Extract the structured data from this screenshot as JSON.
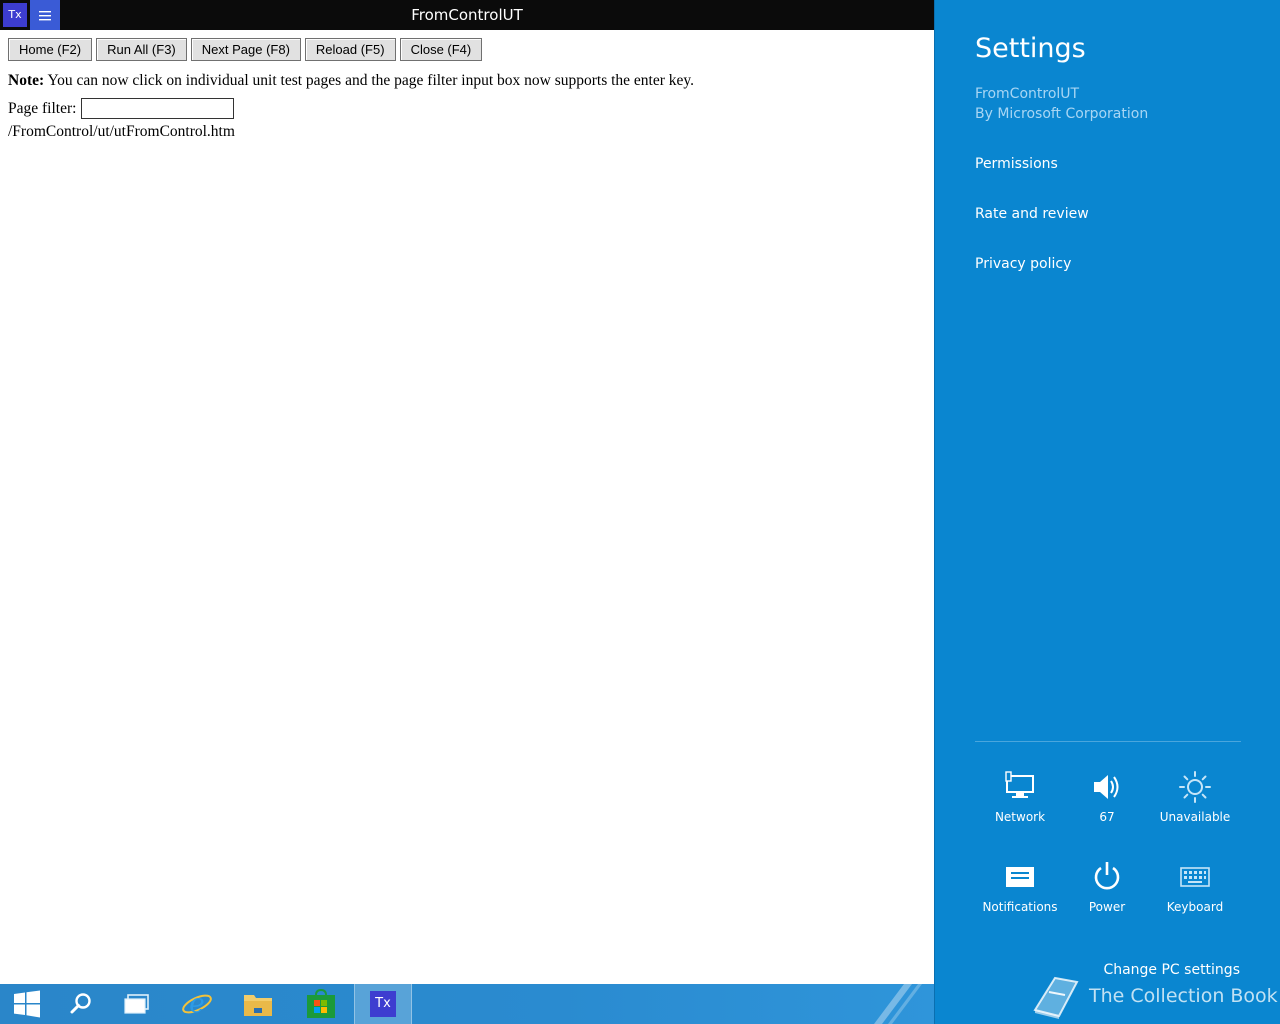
{
  "titlebar": {
    "app_icon_text": "Tx",
    "menu_icon": "hamburger-icon",
    "title": "FromControlUT"
  },
  "toolbar": {
    "buttons": [
      {
        "label": "Home (F2)"
      },
      {
        "label": "Run All (F3)"
      },
      {
        "label": "Next Page (F8)"
      },
      {
        "label": "Reload (F5)"
      },
      {
        "label": "Close (F4)"
      }
    ]
  },
  "content": {
    "note_label": "Note:",
    "note_text": " You can now click on individual unit test pages and the page filter input box now supports the enter key.",
    "filter_label": "Page filter:",
    "filter_value": "",
    "page_link": "/FromControl/ut/utFromControl.htm"
  },
  "settings": {
    "title": "Settings",
    "app_name": "FromControlUT",
    "publisher": "By Microsoft Corporation",
    "links": [
      {
        "label": "Permissions"
      },
      {
        "label": "Rate and review"
      },
      {
        "label": "Privacy policy"
      }
    ],
    "quick": [
      {
        "label": "Network",
        "icon": "network-icon"
      },
      {
        "label": "67",
        "icon": "volume-icon"
      },
      {
        "label": "Unavailable",
        "icon": "brightness-icon"
      },
      {
        "label": "Notifications",
        "icon": "notifications-icon"
      },
      {
        "label": "Power",
        "icon": "power-icon"
      },
      {
        "label": "Keyboard",
        "icon": "keyboard-icon"
      }
    ],
    "change_pc": "Change PC settings"
  },
  "watermark": "The Collection Book",
  "taskbar": {
    "items": [
      "start-icon",
      "search-icon",
      "task-view-icon",
      "internet-explorer-icon",
      "file-explorer-icon",
      "store-icon"
    ],
    "active_app_text": "Tx"
  },
  "colors": {
    "charm_bg": "#0a86d0",
    "taskbar_bg": "#2a86c9",
    "app_tile": "#3d3dd0"
  }
}
